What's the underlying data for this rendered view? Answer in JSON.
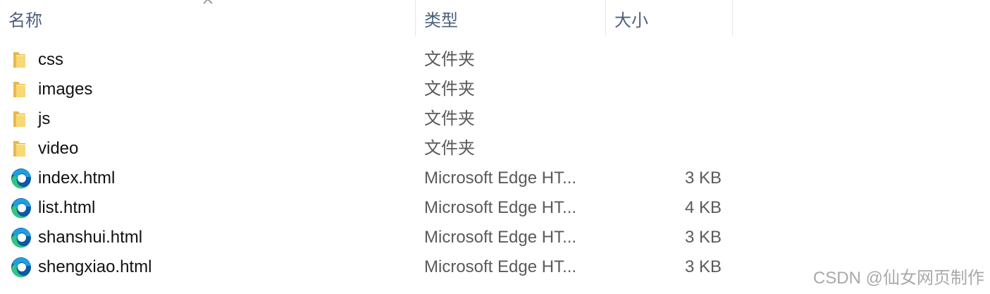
{
  "header": {
    "name_label": "名称",
    "type_label": "类型",
    "size_label": "大小",
    "sort_indicator": "chevron-up-icon"
  },
  "files": [
    {
      "name": "css",
      "type": "文件夹",
      "size": "",
      "icon": "folder-icon"
    },
    {
      "name": "images",
      "type": "文件夹",
      "size": "",
      "icon": "folder-icon"
    },
    {
      "name": "js",
      "type": "文件夹",
      "size": "",
      "icon": "folder-icon"
    },
    {
      "name": "video",
      "type": "文件夹",
      "size": "",
      "icon": "folder-icon"
    },
    {
      "name": "index.html",
      "type": "Microsoft Edge HT...",
      "size": "3 KB",
      "icon": "edge-icon"
    },
    {
      "name": "list.html",
      "type": "Microsoft Edge HT...",
      "size": "4 KB",
      "icon": "edge-icon"
    },
    {
      "name": "shanshui.html",
      "type": "Microsoft Edge HT...",
      "size": "3 KB",
      "icon": "edge-icon"
    },
    {
      "name": "shengxiao.html",
      "type": "Microsoft Edge HT...",
      "size": "3 KB",
      "icon": "edge-icon"
    }
  ],
  "watermark": "CSDN @仙女网页制作",
  "colors": {
    "header_text": "#4c607a",
    "folder": "#f8d775",
    "edge_blue": "#0c59a4",
    "edge_green": "#33c481"
  }
}
